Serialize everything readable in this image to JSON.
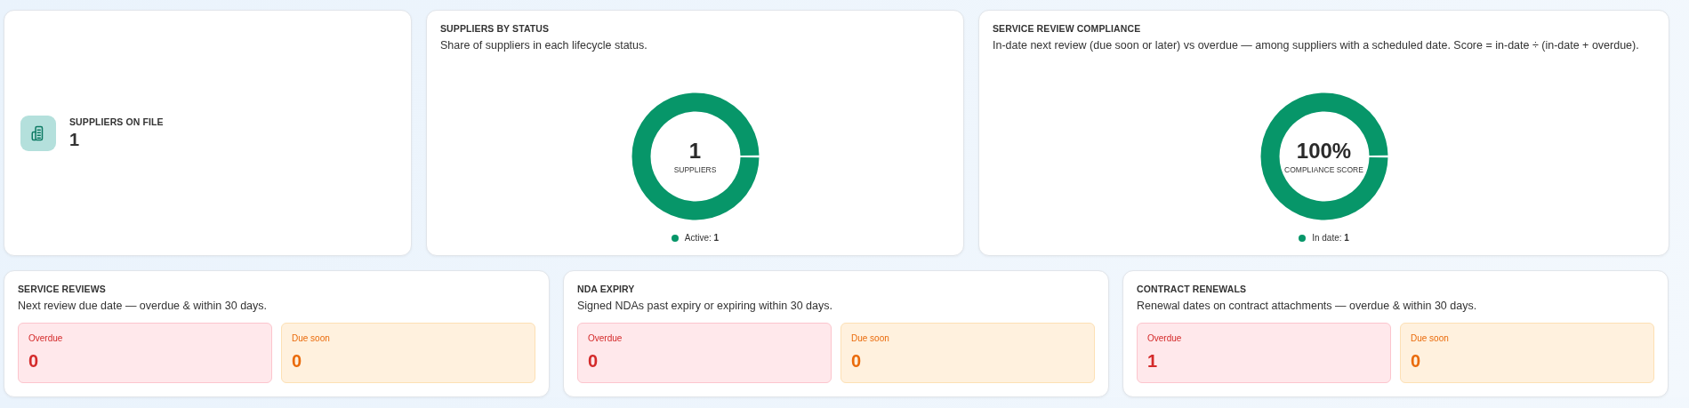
{
  "summary": {
    "title": "SUPPLIERS ON FILE",
    "value": "1"
  },
  "charts": [
    {
      "title": "SUPPLIERS BY STATUS",
      "description": "Share of suppliers in each lifecycle status.",
      "center_value": "1",
      "center_label": "SUPPLIERS",
      "legend": [
        {
          "label": "Active: **1**",
          "color": "#079669"
        }
      ]
    },
    {
      "title": "SERVICE REVIEW COMPLIANCE",
      "description": "In-date next review (due soon or later) vs overdue — among suppliers with a scheduled date. Score = in-date ÷ (in-date + overdue).",
      "center_value": "100%",
      "center_label": "COMPLIANCE SCORE",
      "legend": [
        {
          "label": "In date: **1**",
          "color": "#079669"
        }
      ]
    }
  ],
  "trackers": [
    {
      "title": "SERVICE REVIEWS",
      "description": "Next review due date — overdue & within 30 days.",
      "stats": [
        {
          "kind": "overdue",
          "label": "Overdue",
          "value": "0"
        },
        {
          "kind": "due_soon",
          "label": "Due soon",
          "value": "0"
        }
      ]
    },
    {
      "title": "NDA EXPIRY",
      "description": "Signed NDAs past expiry or expiring within 30 days.",
      "stats": [
        {
          "kind": "overdue",
          "label": "Overdue",
          "value": "0"
        },
        {
          "kind": "due_soon",
          "label": "Due soon",
          "value": "0"
        }
      ]
    },
    {
      "title": "CONTRACT RENEWALS",
      "description": "Renewal dates on contract attachments — overdue & within 30 days.",
      "stats": [
        {
          "kind": "overdue",
          "label": "Overdue",
          "value": "1"
        },
        {
          "kind": "due_soon",
          "label": "Due soon",
          "value": "0"
        }
      ]
    }
  ]
}
